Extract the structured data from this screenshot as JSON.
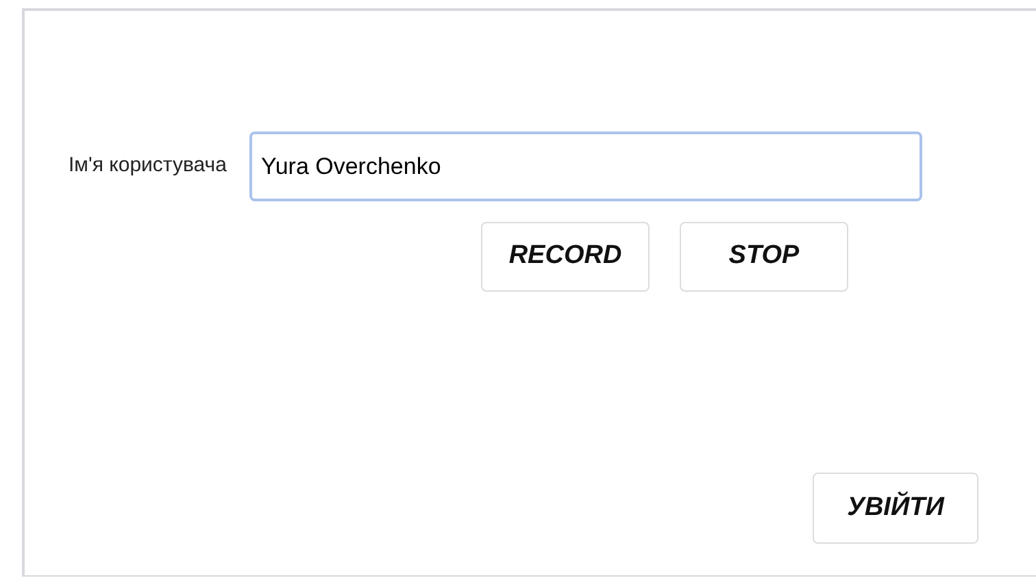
{
  "username": {
    "label": "Ім'я користувача",
    "value": "Yura Overchenko",
    "focused": true
  },
  "buttons": [
    "RECORD",
    "STOP"
  ],
  "login_button": "УВІЙТИ"
}
